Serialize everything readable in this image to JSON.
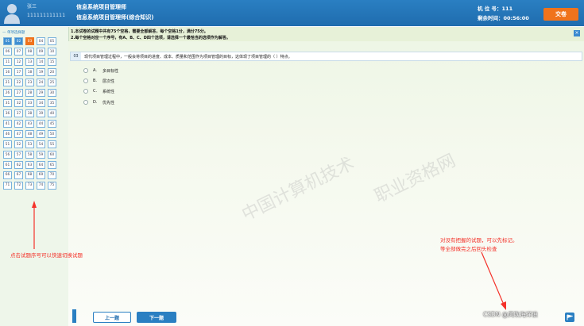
{
  "header": {
    "user_name": "张三",
    "user_id": "111111111111",
    "title_line1": "信息系统项目管理师",
    "title_line2": "信息系统项目管理师(综合知识)",
    "seat_label": "机  位 号：111",
    "timer_label": "剩余时间：00:56:00",
    "submit_label": "交卷"
  },
  "instructions": {
    "line1": "1.本试卷的试题中共有75个空格，需要全部解答，每个空格1分，满分75分。",
    "line2": "2.每个空格对应一个序号，有A、B、C、D四个选项，请选择一个最恰当的选项作为解答。",
    "close_label": "×"
  },
  "sidebar": {
    "section_title": "单项选择题",
    "done_color": "#3f8fd2",
    "current_color": "#f0731c",
    "questions": [
      {
        "n": "01",
        "state": "done"
      },
      {
        "n": "02",
        "state": "done"
      },
      {
        "n": "03",
        "state": "current"
      },
      {
        "n": "04",
        "state": "open"
      },
      {
        "n": "05",
        "state": "open"
      },
      {
        "n": "06",
        "state": "open"
      },
      {
        "n": "07",
        "state": "open"
      },
      {
        "n": "08",
        "state": "open"
      },
      {
        "n": "09",
        "state": "open"
      },
      {
        "n": "10",
        "state": "open"
      },
      {
        "n": "11",
        "state": "open"
      },
      {
        "n": "12",
        "state": "open"
      },
      {
        "n": "13",
        "state": "open"
      },
      {
        "n": "14",
        "state": "open"
      },
      {
        "n": "15",
        "state": "open"
      },
      {
        "n": "16",
        "state": "open"
      },
      {
        "n": "17",
        "state": "open"
      },
      {
        "n": "18",
        "state": "open"
      },
      {
        "n": "19",
        "state": "open"
      },
      {
        "n": "20",
        "state": "open"
      },
      {
        "n": "21",
        "state": "open"
      },
      {
        "n": "22",
        "state": "open"
      },
      {
        "n": "23",
        "state": "open"
      },
      {
        "n": "24",
        "state": "open"
      },
      {
        "n": "25",
        "state": "open"
      },
      {
        "n": "26",
        "state": "open"
      },
      {
        "n": "27",
        "state": "open"
      },
      {
        "n": "28",
        "state": "open"
      },
      {
        "n": "29",
        "state": "open"
      },
      {
        "n": "30",
        "state": "open"
      },
      {
        "n": "31",
        "state": "open"
      },
      {
        "n": "32",
        "state": "open"
      },
      {
        "n": "33",
        "state": "open"
      },
      {
        "n": "34",
        "state": "open"
      },
      {
        "n": "35",
        "state": "open"
      },
      {
        "n": "36",
        "state": "open"
      },
      {
        "n": "37",
        "state": "open"
      },
      {
        "n": "38",
        "state": "open"
      },
      {
        "n": "39",
        "state": "open"
      },
      {
        "n": "40",
        "state": "open"
      },
      {
        "n": "41",
        "state": "open"
      },
      {
        "n": "42",
        "state": "open"
      },
      {
        "n": "43",
        "state": "open"
      },
      {
        "n": "44",
        "state": "open"
      },
      {
        "n": "45",
        "state": "open"
      },
      {
        "n": "46",
        "state": "open"
      },
      {
        "n": "47",
        "state": "open"
      },
      {
        "n": "48",
        "state": "open"
      },
      {
        "n": "49",
        "state": "open"
      },
      {
        "n": "50",
        "state": "open"
      },
      {
        "n": "51",
        "state": "open"
      },
      {
        "n": "52",
        "state": "open"
      },
      {
        "n": "53",
        "state": "open"
      },
      {
        "n": "54",
        "state": "open"
      },
      {
        "n": "55",
        "state": "open"
      },
      {
        "n": "56",
        "state": "open"
      },
      {
        "n": "57",
        "state": "open"
      },
      {
        "n": "58",
        "state": "open"
      },
      {
        "n": "59",
        "state": "open"
      },
      {
        "n": "60",
        "state": "open"
      },
      {
        "n": "61",
        "state": "open"
      },
      {
        "n": "62",
        "state": "open"
      },
      {
        "n": "63",
        "state": "open"
      },
      {
        "n": "64",
        "state": "open"
      },
      {
        "n": "65",
        "state": "open"
      },
      {
        "n": "66",
        "state": "open"
      },
      {
        "n": "67",
        "state": "open"
      },
      {
        "n": "68",
        "state": "open"
      },
      {
        "n": "69",
        "state": "open"
      },
      {
        "n": "70",
        "state": "open"
      },
      {
        "n": "71",
        "state": "open"
      },
      {
        "n": "72",
        "state": "open"
      },
      {
        "n": "73",
        "state": "open"
      },
      {
        "n": "74",
        "state": "open"
      },
      {
        "n": "75",
        "state": "open"
      }
    ]
  },
  "question": {
    "number": "03",
    "text": "现代项目管理过程中，一般会将项目的进度、成本、质量和范围作为项目管理的目标，这体现了项目管理的（    ）特点。",
    "options": [
      {
        "label": "A.",
        "text": "多目标性"
      },
      {
        "label": "B.",
        "text": "层次性"
      },
      {
        "label": "C.",
        "text": "系统性"
      },
      {
        "label": "D.",
        "text": "优先性"
      }
    ]
  },
  "watermark": {
    "line1": "中国计算机技术",
    "line2": "职业资格网"
  },
  "annotations": {
    "left_note": "点击试题序号可以快速切换试题",
    "right_line1": "对没有把握的试题，可以先标记。",
    "right_line2": "等全部做完之后回头检查",
    "color": "#f4322a"
  },
  "footer": {
    "prev_label": "上一题",
    "next_label": "下一题",
    "credit": "CSDN @风吹海洋浪"
  }
}
